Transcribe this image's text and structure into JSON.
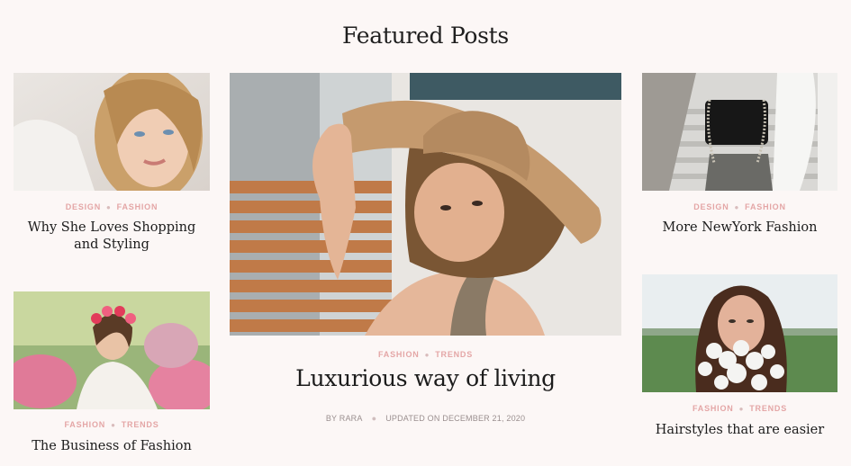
{
  "section": {
    "title": "Featured Posts"
  },
  "posts": {
    "left_top": {
      "categories": [
        "DESIGN",
        "FASHION"
      ],
      "title": "Why She Loves Shopping and Styling"
    },
    "left_bottom": {
      "categories": [
        "FASHION",
        "TRENDS"
      ],
      "title": "The Business of Fashion"
    },
    "center": {
      "categories": [
        "FASHION",
        "TRENDS"
      ],
      "title": "Luxurious way of living",
      "author": "BY RARA",
      "updated": "UPDATED ON DECEMBER 21, 2020"
    },
    "right_top": {
      "categories": [
        "DESIGN",
        "FASHION"
      ],
      "title": "More NewYork Fashion"
    },
    "right_bottom": {
      "categories": [
        "FASHION",
        "TRENDS"
      ],
      "title": "Hairstyles that are easier"
    }
  },
  "colors": {
    "background": "#fcf7f6",
    "category": "#e4a6a6",
    "meta": "#9a8f8f"
  }
}
